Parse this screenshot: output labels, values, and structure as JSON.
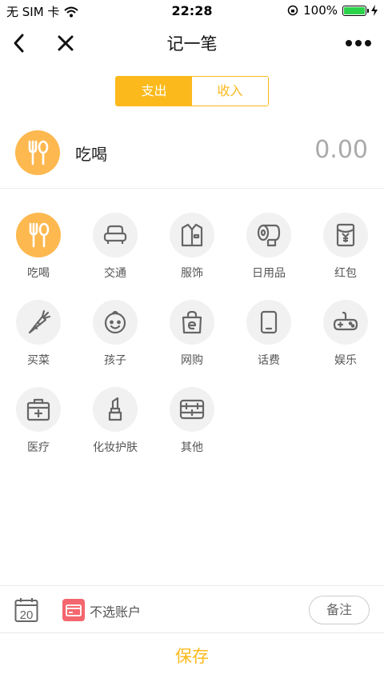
{
  "status_bar": {
    "carrier": "无 SIM 卡",
    "time": "22:28",
    "battery": "100%"
  },
  "nav": {
    "title": "记一笔"
  },
  "segment": {
    "expense": "支出",
    "income": "收入"
  },
  "selected": {
    "name": "吃喝",
    "amount": "0.00"
  },
  "categories": [
    {
      "label": "吃喝",
      "icon": "fork-spoon-icon"
    },
    {
      "label": "交通",
      "icon": "car-seat-icon"
    },
    {
      "label": "服饰",
      "icon": "shirt-icon"
    },
    {
      "label": "日用品",
      "icon": "toilet-paper-icon"
    },
    {
      "label": "红包",
      "icon": "red-envelope-icon"
    },
    {
      "label": "买菜",
      "icon": "carrot-icon"
    },
    {
      "label": "孩子",
      "icon": "baby-face-icon"
    },
    {
      "label": "网购",
      "icon": "shopping-bag-icon"
    },
    {
      "label": "话费",
      "icon": "phone-icon"
    },
    {
      "label": "娱乐",
      "icon": "gamepad-icon"
    },
    {
      "label": "医疗",
      "icon": "medical-kit-icon"
    },
    {
      "label": "化妆护肤",
      "icon": "lipstick-icon"
    },
    {
      "label": "其他",
      "icon": "abacus-icon"
    }
  ],
  "bottom": {
    "calendar_day": "20",
    "account": "不选账户",
    "note": "备注"
  },
  "save": "保存",
  "colors": {
    "accent": "#fbb91c",
    "category_selected": "#fdb84f",
    "card": "#f4666e"
  }
}
